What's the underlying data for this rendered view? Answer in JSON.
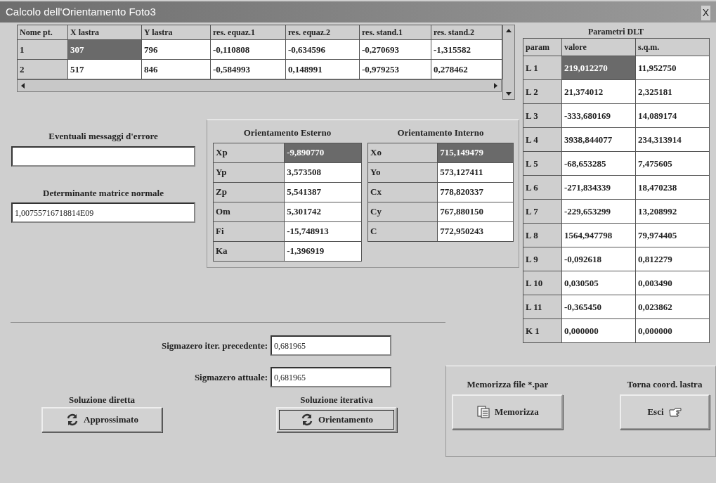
{
  "window": {
    "title": "Calcolo dell'Orientamento Foto3",
    "close": "X"
  },
  "points_grid": {
    "columns": [
      "Nome pt.",
      "X lastra",
      "Y lastra",
      "res. equaz.1",
      "res. equaz.2",
      "res. stand.1",
      "res. stand.2"
    ],
    "rows": [
      {
        "cells": [
          {
            "text": "1",
            "selected": false
          },
          {
            "text": "307",
            "selected": true
          },
          {
            "text": "796",
            "selected": false
          },
          {
            "text": "-0,110808",
            "selected": false
          },
          {
            "text": "-0,634596",
            "selected": false
          },
          {
            "text": "-0,270693",
            "selected": false
          },
          {
            "text": "-1,315582",
            "selected": false
          }
        ]
      },
      {
        "cells": [
          {
            "text": "2",
            "selected": false
          },
          {
            "text": "517",
            "selected": false
          },
          {
            "text": "846",
            "selected": false
          },
          {
            "text": "-0,584993",
            "selected": false
          },
          {
            "text": "0,148991",
            "selected": false
          },
          {
            "text": "-0,979253",
            "selected": false
          },
          {
            "text": "0,278462",
            "selected": false
          }
        ]
      }
    ]
  },
  "errors": {
    "label": "Eventuali messaggi d'errore"
  },
  "determinant": {
    "label": "Determinante matrice normale",
    "value": "1,00755716718814E09"
  },
  "exterior": {
    "title": "Orientamento Esterno",
    "rows": [
      {
        "label": "Xp",
        "value": "-9,890770",
        "selected": true
      },
      {
        "label": "Yp",
        "value": "3,573508",
        "selected": false
      },
      {
        "label": "Zp",
        "value": "5,541387",
        "selected": false
      },
      {
        "label": "Om",
        "value": "5,301742",
        "selected": false
      },
      {
        "label": "Fi",
        "value": "-15,748913",
        "selected": false
      },
      {
        "label": "Ka",
        "value": "-1,396919",
        "selected": false
      }
    ]
  },
  "interior": {
    "title": "Orientamento Interno",
    "rows": [
      {
        "label": "Xo",
        "value": "715,149479",
        "selected": true
      },
      {
        "label": "Yo",
        "value": "573,127411",
        "selected": false
      },
      {
        "label": "Cx",
        "value": "778,820337",
        "selected": false
      },
      {
        "label": "Cy",
        "value": "767,880150",
        "selected": false
      },
      {
        "label": "C",
        "value": "772,950243",
        "selected": false
      }
    ]
  },
  "dlt": {
    "title": "Parametri DLT",
    "columns": [
      "param",
      "valore",
      "s.q.m."
    ],
    "rows": [
      {
        "param": "L 1",
        "value": "219,012270",
        "sqm": "11,952750",
        "selected": true
      },
      {
        "param": "L 2",
        "value": "21,374012",
        "sqm": "2,325181",
        "selected": false
      },
      {
        "param": "L 3",
        "value": "-333,680169",
        "sqm": "14,089174",
        "selected": false
      },
      {
        "param": "L 4",
        "value": "3938,844077",
        "sqm": "234,313914",
        "selected": false
      },
      {
        "param": "L 5",
        "value": "-68,653285",
        "sqm": "7,475605",
        "selected": false
      },
      {
        "param": "L 6",
        "value": "-271,834339",
        "sqm": "18,470238",
        "selected": false
      },
      {
        "param": "L 7",
        "value": "-229,653299",
        "sqm": "13,208992",
        "selected": false
      },
      {
        "param": "L 8",
        "value": "1564,947798",
        "sqm": "79,974405",
        "selected": false
      },
      {
        "param": "L 9",
        "value": "-0,092618",
        "sqm": "0,812279",
        "selected": false
      },
      {
        "param": "L 10",
        "value": "0,030505",
        "sqm": "0,003490",
        "selected": false
      },
      {
        "param": "L 11",
        "value": "-0,365450",
        "sqm": "0,023862",
        "selected": false
      },
      {
        "param": "K 1",
        "value": "0,000000",
        "sqm": "0,000000",
        "selected": false
      }
    ]
  },
  "sigma": [
    {
      "label": "Sigmazero iter. precedente:",
      "value": "0,681965"
    },
    {
      "label": "Sigmazero attuale:",
      "value": "0,681965"
    }
  ],
  "actions": [
    {
      "caption": "Soluzione diretta",
      "label": "Approssimato",
      "focused": false
    },
    {
      "caption": "Soluzione iterativa",
      "label": "Orientamento",
      "focused": true
    }
  ],
  "file_actions": [
    {
      "caption": "Memorizza file *.par",
      "label": "Memorizza"
    },
    {
      "caption": "Torna coord. lastra",
      "label": "Esci"
    }
  ]
}
